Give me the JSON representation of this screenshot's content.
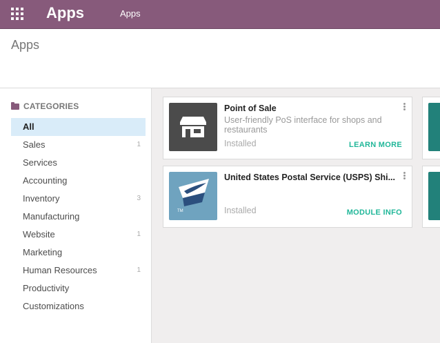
{
  "navbar": {
    "brand": "Apps",
    "menu_item": "Apps",
    "color": "#875a7b"
  },
  "control_panel": {
    "breadcrumb": "Apps"
  },
  "sidebar": {
    "header": "CATEGORIES",
    "items": [
      {
        "label": "All",
        "count": "",
        "active": true
      },
      {
        "label": "Sales",
        "count": "1"
      },
      {
        "label": "Services",
        "count": ""
      },
      {
        "label": "Accounting",
        "count": ""
      },
      {
        "label": "Inventory",
        "count": "3"
      },
      {
        "label": "Manufacturing",
        "count": ""
      },
      {
        "label": "Website",
        "count": "1"
      },
      {
        "label": "Marketing",
        "count": ""
      },
      {
        "label": "Human Resources",
        "count": "1"
      },
      {
        "label": "Productivity",
        "count": ""
      },
      {
        "label": "Customizations",
        "count": ""
      }
    ]
  },
  "apps": [
    {
      "title": "Point of Sale",
      "description": "User-friendly PoS interface for shops and restaurants",
      "status": "Installed",
      "action": "LEARN MORE",
      "icon": "shop-icon",
      "icon_color": "#4b4b4b"
    },
    {
      "title": "United States Postal Service (USPS) Shi...",
      "description": "",
      "status": "Installed",
      "action": "MODULE INFO",
      "icon": "usps-eagle-icon",
      "icon_color": "#6fa3bf"
    }
  ],
  "accent_color": "#21b799"
}
